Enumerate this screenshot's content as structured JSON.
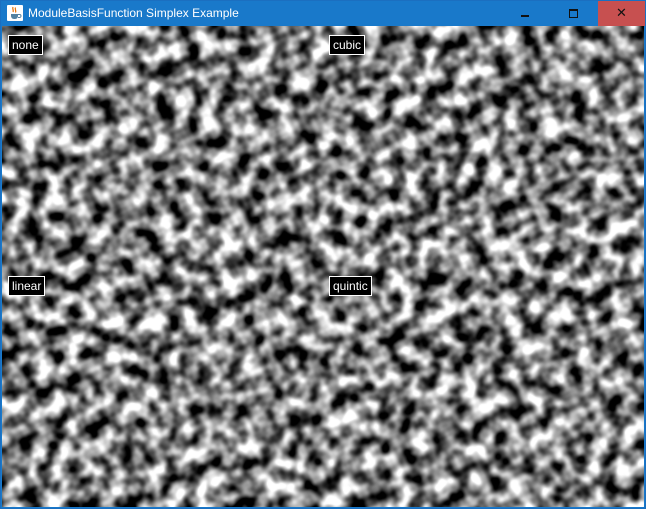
{
  "window": {
    "title": "ModuleBasisFunction Simplex Example",
    "controls": {
      "minimize": "minimize",
      "maximize": "maximize",
      "close": "close"
    },
    "colors": {
      "titlebar": "#1979ca",
      "close_button": "#c75050",
      "title_text": "#ffffff"
    }
  },
  "panels": [
    {
      "label": "none",
      "interpolation": "none"
    },
    {
      "label": "cubic",
      "interpolation": "cubic"
    },
    {
      "label": "linear",
      "interpolation": "linear"
    },
    {
      "label": "quintic",
      "interpolation": "quintic"
    }
  ],
  "icons": {
    "app": "java-coffee-cup-icon"
  }
}
